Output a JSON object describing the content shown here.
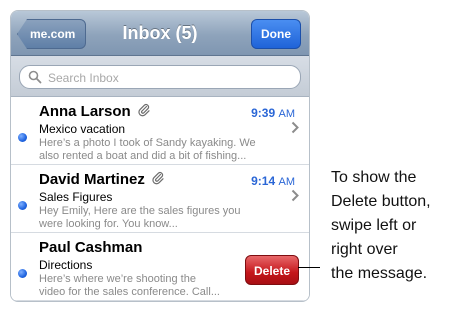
{
  "navbar": {
    "back_label": "me.com",
    "title": "Inbox (5)",
    "done_label": "Done"
  },
  "search": {
    "placeholder": "Search Inbox",
    "value": ""
  },
  "messages": [
    {
      "sender": "Anna Larson",
      "has_attachment": true,
      "time": "9:39",
      "ampm": "AM",
      "subject": "Mexico vacation",
      "preview_line1": "Here’s a photo I took of Sandy kayaking. We",
      "preview_line2": "also rented a boat and did a bit of fishing...",
      "unread": true
    },
    {
      "sender": "David Martinez",
      "has_attachment": true,
      "time": "9:14",
      "ampm": "AM",
      "subject": "Sales Figures",
      "preview_line1": "Hey Emily, Here are the sales figures you",
      "preview_line2": "were looking for. You know...",
      "unread": true
    },
    {
      "sender": "Paul Cashman",
      "has_attachment": false,
      "subject": "Directions",
      "preview_line1": "Here’s where we’re shooting the",
      "preview_line2": "video for the sales conference. Call...",
      "unread": true,
      "delete_label": "Delete"
    }
  ],
  "callout": {
    "lines": [
      "To show the",
      "Delete button,",
      "swipe left or",
      "right over",
      "the message."
    ]
  },
  "colors": {
    "accent_blue": "#2a66d6",
    "delete_red": "#c4161b",
    "navbar": "#8ea3bb"
  }
}
